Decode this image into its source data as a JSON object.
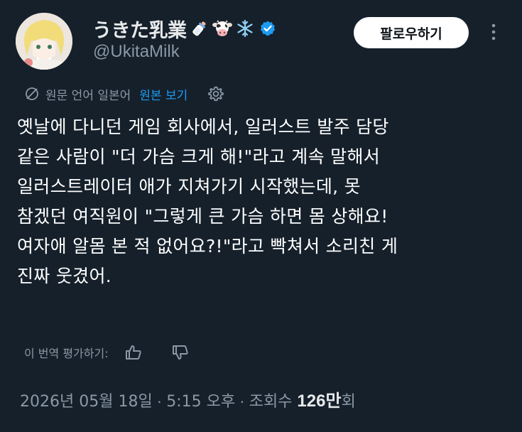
{
  "author": {
    "display_name": "うきた乳業",
    "handle": "@UkitaMilk",
    "name_emojis": [
      "baby-bottle-icon",
      "cow-icon",
      "snowflake-icon"
    ],
    "verified": true
  },
  "header": {
    "follow_label": "팔로우하기"
  },
  "translation": {
    "source_label": "원문 언어 일본어",
    "original_link": "원본 보기"
  },
  "tweet": {
    "text": "옛날에 다니던 게임 회사에서, 일러스트 발주 담당\n같은 사람이 \"더 가슴 크게 해!\"라고 계속 말해서\n일러스트레이터 애가 지쳐가기 시작했는데, 못\n참겠던 여직원이 \"그렇게 큰 가슴 하면 몸 상해요!\n여자애 알몸 본 적 없어요?!\"라고 빡쳐서 소리친 게\n진짜 웃겼어."
  },
  "rating": {
    "label": "이 번역 평가하기:"
  },
  "meta": {
    "date": "2026년 05월 18일",
    "sep1": " · ",
    "time": "5:15 오후",
    "sep2": " · ",
    "views_label": "조회수 ",
    "views_num": "126",
    "views_unit": "만회"
  },
  "colors": {
    "background": "#15202b",
    "accent": "#1d9bf0",
    "text_muted": "#8b98a5"
  }
}
